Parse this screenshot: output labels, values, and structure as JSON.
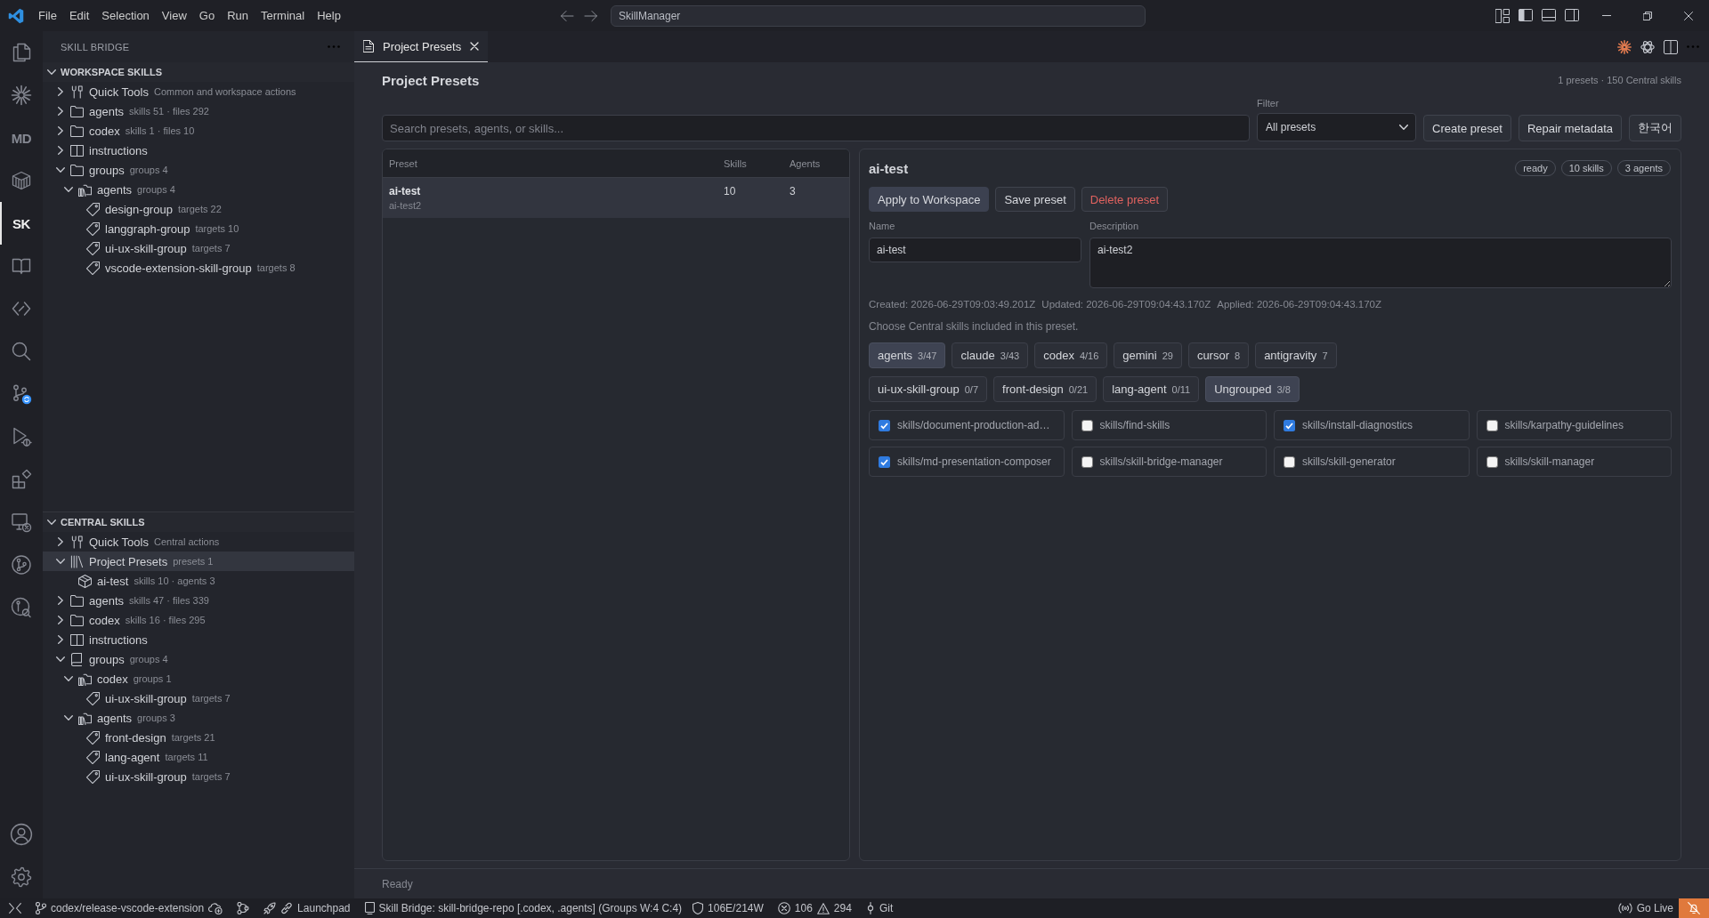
{
  "title_bar": {
    "menu": [
      "File",
      "Edit",
      "Selection",
      "View",
      "Go",
      "Run",
      "Terminal",
      "Help"
    ],
    "command_center": "SkillManager"
  },
  "activity_bar": {
    "items": [
      {
        "selected": false
      },
      {
        "selected": false
      },
      {
        "glyph": "MD",
        "selected": false
      },
      {
        "selected": false
      },
      {
        "glyph": "SK",
        "selected": true
      },
      {
        "selected": false
      },
      {
        "selected": false
      },
      {
        "selected": false
      },
      {
        "selected": false
      },
      {
        "selected": false
      },
      {
        "selected": false
      },
      {
        "selected": false
      },
      {
        "selected": false
      },
      {
        "selected": false
      }
    ]
  },
  "sidebar": {
    "title": "SKILL BRIDGE",
    "sections": [
      {
        "title": "WORKSPACE SKILLS",
        "expanded": true,
        "items": [
          {
            "kind": "tools",
            "label": "Quick Tools",
            "detail": "Common and workspace actions",
            "expanded": false,
            "selected": false
          },
          {
            "kind": "folder",
            "label": "agents",
            "detail": "skills 51 · files 292",
            "expanded": false,
            "selected": false
          },
          {
            "kind": "folder",
            "label": "codex",
            "detail": "skills 1 · files 10",
            "expanded": false,
            "selected": false
          },
          {
            "kind": "docs",
            "label": "instructions",
            "expanded": false,
            "selected": false
          },
          {
            "kind": "folder",
            "label": "groups",
            "detail": "groups 4",
            "expanded": true,
            "selected": false,
            "children": [
              {
                "kind": "group-folder",
                "label": "agents",
                "detail": "groups 4",
                "expanded": true,
                "selected": false,
                "children": [
                  {
                    "kind": "group",
                    "label": "design-group",
                    "detail": "targets 22",
                    "selected": false
                  },
                  {
                    "kind": "group",
                    "label": "langgraph-group",
                    "detail": "targets 10",
                    "selected": false
                  },
                  {
                    "kind": "group",
                    "label": "ui-ux-skill-group",
                    "detail": "targets 7",
                    "selected": false
                  },
                  {
                    "kind": "group",
                    "label": "vscode-extension-skill-group",
                    "detail": "targets 8",
                    "selected": false
                  }
                ]
              }
            ]
          }
        ]
      },
      {
        "title": "CENTRAL SKILLS",
        "expanded": true,
        "items": [
          {
            "kind": "tools",
            "label": "Quick Tools",
            "detail": "Central actions",
            "expanded": false,
            "selected": false
          },
          {
            "kind": "presets",
            "label": "Project Presets",
            "detail": "presets 1",
            "expanded": true,
            "selected": true,
            "children": [
              {
                "kind": "preset",
                "label": "ai-test",
                "detail": "skills 10 · agents 3",
                "selected": false
              }
            ]
          },
          {
            "kind": "folder",
            "label": "agents",
            "detail": "skills 47 · files 339",
            "expanded": false,
            "selected": false
          },
          {
            "kind": "folder",
            "label": "codex",
            "detail": "skills 16 · files 295",
            "expanded": false,
            "selected": false
          },
          {
            "kind": "docs",
            "label": "instructions",
            "expanded": false,
            "selected": false
          },
          {
            "kind": "book",
            "label": "groups",
            "detail": "groups 4",
            "expanded": true,
            "selected": false,
            "children": [
              {
                "kind": "group-folder",
                "label": "codex",
                "detail": "groups 1",
                "expanded": true,
                "selected": false,
                "children": [
                  {
                    "kind": "group",
                    "label": "ui-ux-skill-group",
                    "detail": "targets 7",
                    "selected": false
                  }
                ]
              },
              {
                "kind": "group-folder",
                "label": "agents",
                "detail": "groups 3",
                "expanded": true,
                "selected": false,
                "children": [
                  {
                    "kind": "group",
                    "label": "front-design",
                    "detail": "targets 21",
                    "selected": false
                  },
                  {
                    "kind": "group",
                    "label": "lang-agent",
                    "detail": "targets 11",
                    "selected": false
                  },
                  {
                    "kind": "group",
                    "label": "ui-ux-skill-group",
                    "detail": "targets 7",
                    "selected": false
                  }
                ]
              }
            ]
          }
        ]
      }
    ]
  },
  "tabs": [
    {
      "label": "Project Presets",
      "selected": true
    }
  ],
  "page": {
    "title": "Project Presets",
    "summary": "1 presets · 150 Central skills",
    "search": {
      "placeholder": "Search presets, agents, or skills..."
    },
    "filter": {
      "label": "Filter",
      "value": "All presets"
    },
    "actions": [
      "Create preset",
      "Repair metadata",
      "한국어"
    ],
    "table": {
      "columns": [
        "Preset",
        "Skills",
        "Agents"
      ],
      "rows": [
        {
          "name": "ai-test",
          "description": "ai-test2",
          "skills": "10",
          "agents": "3",
          "selected": true
        }
      ]
    },
    "detail": {
      "title": "ai-test",
      "badges": [
        "ready",
        "10 skills",
        "3 agents"
      ],
      "buttons": [
        {
          "label": "Apply to Workspace",
          "kind": "primary"
        },
        {
          "label": "Save preset",
          "kind": "secondary"
        },
        {
          "label": "Delete preset",
          "kind": "danger"
        }
      ],
      "name": {
        "label": "Name",
        "value": "ai-test"
      },
      "description": {
        "label": "Description",
        "value": "ai-test2"
      },
      "meta": [
        "Created: 2026-06-29T09:03:49.201Z",
        "Updated: 2026-06-29T09:04:43.170Z",
        "Applied: 2026-06-29T09:04:43.170Z"
      ],
      "hint": "Choose Central skills included in this preset.",
      "agent_chips": [
        {
          "label": "agents",
          "count": "3/47",
          "selected": true
        },
        {
          "label": "claude",
          "count": "3/43",
          "selected": false
        },
        {
          "label": "codex",
          "count": "4/16",
          "selected": false
        },
        {
          "label": "gemini",
          "count": "29",
          "selected": false
        },
        {
          "label": "cursor",
          "count": "8",
          "selected": false
        },
        {
          "label": "antigravity",
          "count": "7",
          "selected": false
        }
      ],
      "group_chips": [
        {
          "label": "ui-ux-skill-group",
          "count": "0/7",
          "selected": false
        },
        {
          "label": "front-design",
          "count": "0/21",
          "selected": false
        },
        {
          "label": "lang-agent",
          "count": "0/11",
          "selected": false
        },
        {
          "label": "Ungrouped",
          "count": "3/8",
          "selected": true
        }
      ],
      "skills": [
        {
          "label": "skills/document-production-ad…",
          "checked": true
        },
        {
          "label": "skills/find-skills",
          "checked": false
        },
        {
          "label": "skills/install-diagnostics",
          "checked": true
        },
        {
          "label": "skills/karpathy-guidelines",
          "checked": false
        },
        {
          "label": "skills/md-presentation-composer",
          "checked": true
        },
        {
          "label": "skills/skill-bridge-manager",
          "checked": false
        },
        {
          "label": "skills/skill-generator",
          "checked": false
        },
        {
          "label": "skills/skill-manager",
          "checked": false
        }
      ]
    },
    "footer": "Ready"
  },
  "status_bar": {
    "items": [
      {
        "kind": "remote"
      },
      {
        "kind": "branch",
        "text": "codex/release-vscode-extension"
      },
      {
        "kind": "graph"
      },
      {
        "kind": "launchpad",
        "text": "Launchpad"
      },
      {
        "kind": "skill-bridge",
        "text": "Skill Bridge: skill-bridge-repo [.codex, .agents] (Groups W:4 C:4)"
      },
      {
        "kind": "lint",
        "text": "106E/214W"
      },
      {
        "kind": "problems",
        "errors": "106",
        "warnings": "294"
      },
      {
        "kind": "git",
        "text": "Git"
      }
    ],
    "right_items": [
      {
        "kind": "live",
        "text": "Go Live"
      },
      {
        "kind": "alert"
      }
    ]
  }
}
